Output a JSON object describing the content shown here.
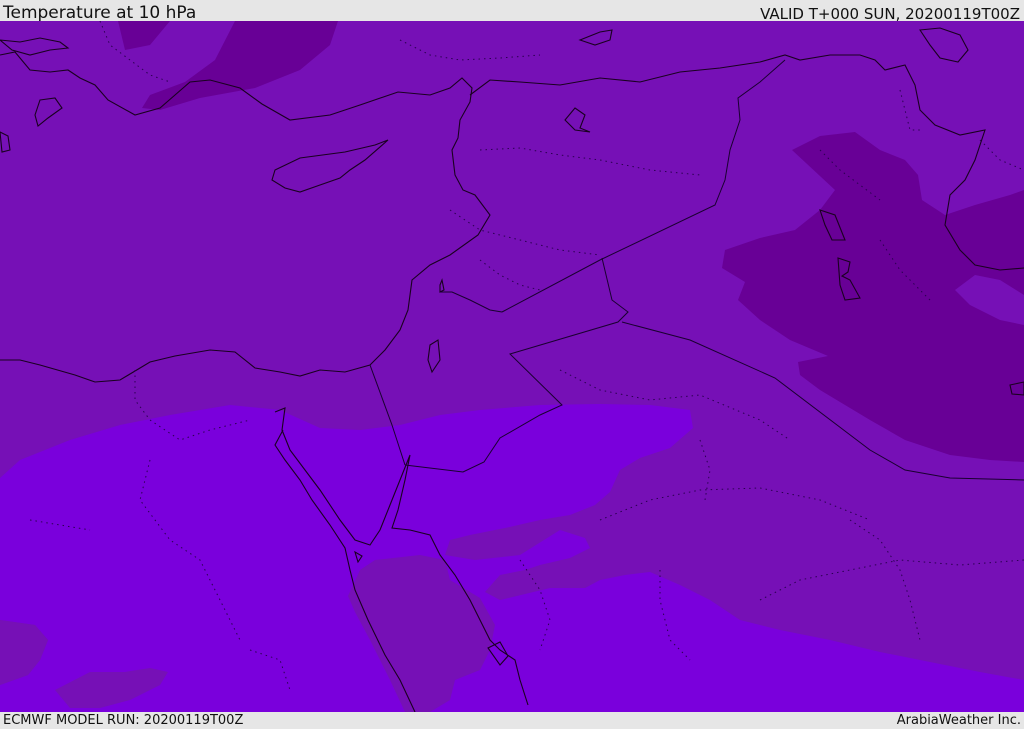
{
  "header": {
    "title": "Temperature at 10 hPa",
    "valid": "VALID T+000 SUN, 20200119T00Z"
  },
  "footer": {
    "model_run": "ECMWF MODEL RUN: 20200119T00Z",
    "credit": "ArabiaWeather Inc."
  },
  "colors": {
    "mid_band": "#7610b6",
    "cold_band": "#680096",
    "warm_band": "#7a00dc",
    "coastline": "#1a0020",
    "border": "#1a0030"
  }
}
